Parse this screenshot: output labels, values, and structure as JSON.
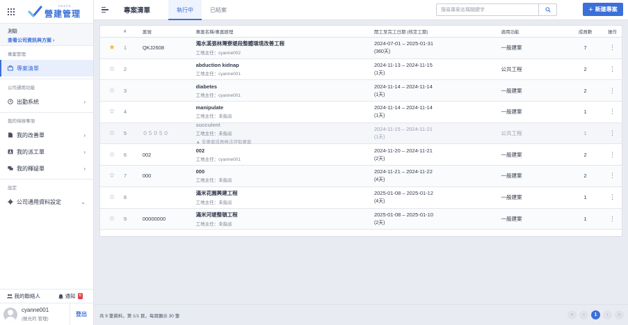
{
  "app": {
    "logo_small": "DEEPS",
    "logo_title": "營建管理"
  },
  "company": {
    "name": "測驗",
    "link": "查看公司資訊與方案 ›"
  },
  "sidebar": {
    "sec_project": "專案管理",
    "project_list": "專案清單",
    "sec_company": "公司通用功能",
    "attendance": "出勤系統",
    "sec_todo": "我的待辦事項",
    "improvement": "我的改善單",
    "dispatch": "我的派工單",
    "query": "我的釋疑單",
    "sec_settings": "設定",
    "company_settings": "公司通用資料設定"
  },
  "bottom": {
    "contacts": "我的聯絡人",
    "notify": "通知",
    "notify_count": "6",
    "user_name": "cyanne001",
    "user_role": "(極光的 管理)",
    "logout": "登出"
  },
  "header": {
    "title": "專案清單",
    "tab_active": "執行中",
    "tab_closed": "已結案",
    "search_placeholder": "搜尋專案名稱關鍵字",
    "new_button": "新建專案"
  },
  "table": {
    "headers": {
      "num": "#",
      "code": "案號",
      "name": "專案名稱/專案經理",
      "date": "開工至完工日期 (核定工期)",
      "func": "適用功能",
      "count": "成員數",
      "op": "操作"
    },
    "rows": [
      {
        "num": "1",
        "code": "QKJ2608",
        "name": "濁水溪張林灣寮堤段整體環境改善工程",
        "manager": "工地主任：cyanne002",
        "range": "2024-07-01 – 2025-01-31",
        "days": "(360天)",
        "func": "一般建案",
        "count": "7",
        "star": "★"
      },
      {
        "num": "2",
        "code": "",
        "name": "abduction kidnap",
        "manager": "工地主任：cyanne001",
        "range": "2024-11-13 – 2024-11-15",
        "days": "(1天)",
        "func": "公共工程",
        "count": "2",
        "star": "☆"
      },
      {
        "num": "3",
        "code": "",
        "name": "diabetes",
        "manager": "工地主任：cyanne001",
        "range": "2024-11-14 – 2024-11-14",
        "days": "(1天)",
        "func": "一般建案",
        "count": "2",
        "star": "☆"
      },
      {
        "num": "4",
        "code": "",
        "name": "manipulate",
        "manager": "工地主任：未指派",
        "range": "2024-11-14 – 2024-11-14",
        "days": "(1天)",
        "func": "一般建案",
        "count": "1",
        "star": "☆"
      },
      {
        "num": "5",
        "code": "０５０５０",
        "name": "succulent",
        "manager": "工地主任：未指派",
        "warn": "▲ 非專案成員無法存取專案",
        "range": "2024-11-15 – 2024-11-21",
        "days": "(1天)",
        "func": "公共工程",
        "count": "1",
        "star": "☆"
      },
      {
        "num": "6",
        "code": "002",
        "name": "002",
        "manager": "工地主任：cyanne001",
        "range": "2024-11-20 – 2024-11-21",
        "days": "(2天)",
        "func": "一般建案",
        "count": "2",
        "star": "☆"
      },
      {
        "num": "7",
        "code": "000",
        "name": "000",
        "manager": "工地主任：未指派",
        "range": "2024-11-21 – 2024-11-22",
        "days": "(4天)",
        "func": "一般建案",
        "count": "2",
        "star": "☆"
      },
      {
        "num": "8",
        "code": "",
        "name": "滿米花園興建工程",
        "manager": "工地主任：未指派",
        "range": "2025-01-08 – 2025-01-12",
        "days": "(4天)",
        "func": "一般建案",
        "count": "1",
        "star": "☆"
      },
      {
        "num": "9",
        "code": "00000000",
        "name": "滿米河堤整頓工程",
        "manager": "工地主任：未指派",
        "range": "2025-01-08 – 2025-01-10",
        "days": "(2天)",
        "func": "一般建案",
        "count": "1",
        "star": "☆"
      }
    ]
  },
  "footer": {
    "summary": "共 9 筆資料，第 1/1 頁，每頁顯示 30 筆",
    "first": "«",
    "prev": "‹",
    "page": "1",
    "next": "›",
    "last": "»"
  },
  "colors": {
    "accent": "#3b6fd9",
    "star": "#f2b43c",
    "badge": "#e0414b"
  },
  "icons": {
    "apps": "grid-icon",
    "collapse": "menu-collapse-icon",
    "search": "search-icon",
    "kebab": "more-vertical-icon"
  }
}
